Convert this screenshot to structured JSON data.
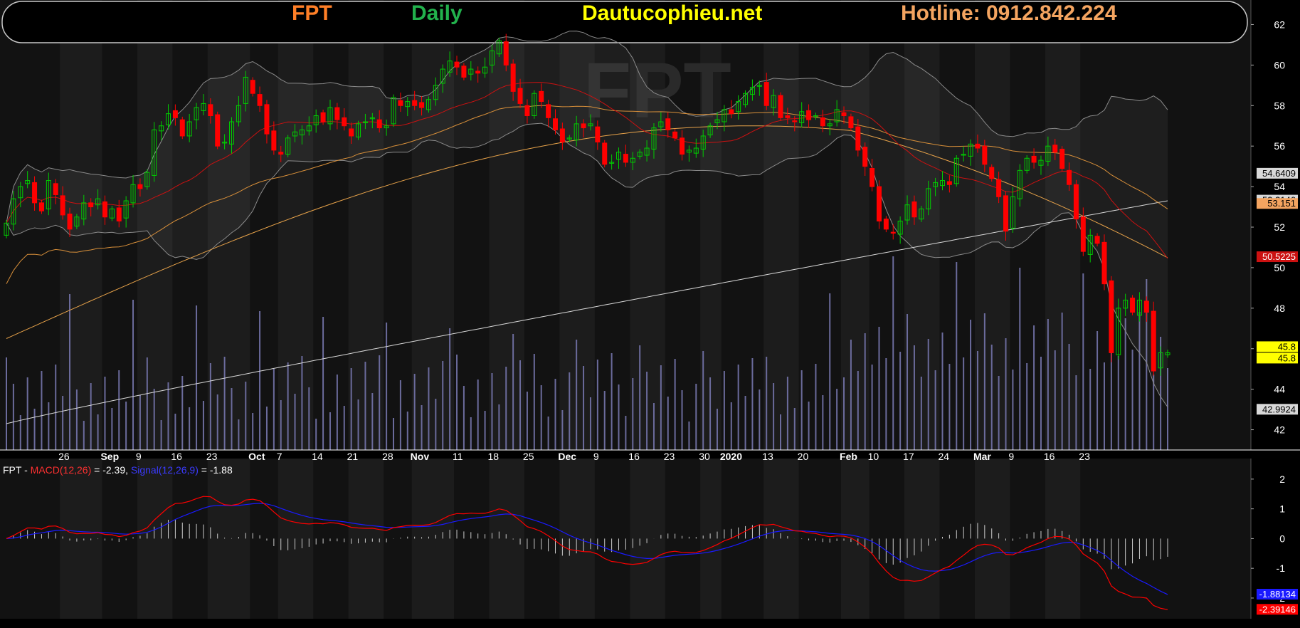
{
  "header": {
    "symbol": "FPT",
    "period": "Daily",
    "site": "Dautucophieu.net",
    "hotline": "Hotline: 0912.842.224",
    "watermark": "FPT"
  },
  "colors": {
    "background": "#000000",
    "pane": "#121212",
    "band": "#1c1c1c",
    "up": "#00cc00",
    "down": "#ff0000",
    "ma20": "#cc1111",
    "ma50": "#d9903a",
    "ma100": "#e8a34a",
    "ma200": "#d8d8d8",
    "bollinger": "#8a8a8a",
    "volume": "#6b6b9c",
    "macd": "#ff0000",
    "signal": "#1a1aff",
    "hist": "#cccccc",
    "symbol": "#ff7f27",
    "period": "#22b14c",
    "site": "#ffff00",
    "hotline": "#f4a460"
  },
  "macd_legend": {
    "symbol": "FPT",
    "sep1": " - ",
    "macd_label": "MACD(12,26)",
    "macd_value": " = -2.39, ",
    "signal_label": "Signal(12,26,9)",
    "signal_value": " = -1.88"
  },
  "price_tags": [
    {
      "text": "54.6409",
      "value": 54.6409,
      "bg": "#d8d8d8",
      "fg": "#000000"
    },
    {
      "text": "53.3146",
      "value": 53.3146,
      "bg": "#d8d8d8",
      "fg": "#000000"
    },
    {
      "text": "53.151",
      "value": 53.151,
      "bg": "#f4a460",
      "fg": "#000000"
    },
    {
      "text": "50.5225",
      "value": 50.5225,
      "bg": "#cc1111",
      "fg": "#ffffff"
    },
    {
      "text": "45.8",
      "value": 45.8,
      "bg": "#ffff00",
      "fg": "#000000",
      "dy": -8
    },
    {
      "text": "45.8",
      "value": 45.8,
      "bg": "#ffff00",
      "fg": "#000000",
      "dy": 8
    },
    {
      "text": "42.9924",
      "value": 42.9924,
      "bg": "#d8d8d8",
      "fg": "#000000"
    }
  ],
  "macd_tags": [
    {
      "text": "-1.88134",
      "value": -1.88134,
      "bg": "#1a1aff",
      "fg": "#ffffff"
    },
    {
      "text": "-2.39146",
      "value": -2.39146,
      "bg": "#ff0000",
      "fg": "#ffffff"
    }
  ],
  "chart_data": [
    {
      "type": "candlestick",
      "ylim": [
        41,
        63
      ],
      "y_ticks": [
        42,
        44,
        46,
        48,
        50,
        52,
        54,
        56,
        58,
        60,
        62
      ],
      "grid": false,
      "x_tick_labels": [
        {
          "label": "26",
          "bar": 8,
          "bold": false
        },
        {
          "label": "Sep",
          "bar": 14,
          "bold": true
        },
        {
          "label": "9",
          "bar": 19,
          "bold": false
        },
        {
          "label": "16",
          "bar": 24,
          "bold": false
        },
        {
          "label": "23",
          "bar": 29,
          "bold": false
        },
        {
          "label": "Oct",
          "bar": 35,
          "bold": true
        },
        {
          "label": "7",
          "bar": 39,
          "bold": false
        },
        {
          "label": "14",
          "bar": 44,
          "bold": false
        },
        {
          "label": "21",
          "bar": 49,
          "bold": false
        },
        {
          "label": "28",
          "bar": 54,
          "bold": false
        },
        {
          "label": "Nov",
          "bar": 58,
          "bold": true
        },
        {
          "label": "11",
          "bar": 64,
          "bold": false
        },
        {
          "label": "18",
          "bar": 69,
          "bold": false
        },
        {
          "label": "25",
          "bar": 74,
          "bold": false
        },
        {
          "label": "Dec",
          "bar": 79,
          "bold": true
        },
        {
          "label": "9",
          "bar": 84,
          "bold": false
        },
        {
          "label": "16",
          "bar": 89,
          "bold": false
        },
        {
          "label": "23",
          "bar": 94,
          "bold": false
        },
        {
          "label": "30",
          "bar": 99,
          "bold": false
        },
        {
          "label": "2020",
          "bar": 102,
          "bold": true
        },
        {
          "label": "13",
          "bar": 108,
          "bold": false
        },
        {
          "label": "20",
          "bar": 113,
          "bold": false
        },
        {
          "label": "Feb",
          "bar": 119,
          "bold": true
        },
        {
          "label": "10",
          "bar": 123,
          "bold": false
        },
        {
          "label": "17",
          "bar": 128,
          "bold": false
        },
        {
          "label": "24",
          "bar": 133,
          "bold": false
        },
        {
          "label": "Mar",
          "bar": 138,
          "bold": true
        },
        {
          "label": "9",
          "bar": 143,
          "bold": false
        },
        {
          "label": "16",
          "bar": 148,
          "bold": false
        },
        {
          "label": "23",
          "bar": 153,
          "bold": false
        }
      ],
      "close": [
        52.2,
        53.4,
        54.0,
        54.3,
        53.2,
        52.8,
        54.3,
        53.6,
        52.6,
        51.9,
        52.5,
        53.2,
        53.0,
        53.4,
        52.5,
        52.9,
        52.3,
        53.3,
        54.1,
        53.9,
        54.7,
        56.8,
        57.0,
        57.6,
        57.4,
        56.5,
        57.2,
        57.9,
        58.1,
        57.5,
        56.0,
        56.2,
        57.2,
        58.0,
        59.4,
        58.6,
        58.0,
        56.6,
        55.8,
        55.6,
        56.4,
        56.7,
        56.8,
        57.0,
        57.5,
        57.2,
        57.9,
        57.3,
        57.0,
        56.5,
        57.1,
        57.2,
        57.4,
        56.9,
        57.0,
        58.4,
        58.0,
        58.2,
        58.0,
        57.9,
        58.3,
        59.0,
        59.8,
        60.2,
        59.9,
        59.4,
        59.8,
        59.6,
        59.9,
        60.7,
        61.2,
        60.0,
        58.7,
        58.1,
        57.5,
        58.6,
        58.2,
        57.4,
        56.8,
        56.2,
        56.4,
        57.1,
        56.9,
        57.1,
        56.2,
        55.1,
        55.2,
        55.7,
        55.2,
        55.4,
        55.7,
        55.9,
        56.9,
        57.2,
        56.8,
        56.4,
        55.6,
        55.8,
        55.9,
        56.5,
        57.0,
        57.3,
        57.8,
        57.6,
        58.2,
        58.6,
        58.9,
        59.0,
        58.0,
        58.5,
        57.4,
        57.4,
        57.2,
        57.7,
        57.3,
        57.5,
        57.0,
        57.1,
        57.8,
        57.5,
        56.9,
        55.8,
        55.0,
        54.0,
        52.3,
        51.9,
        51.7,
        52.3,
        53.1,
        52.5,
        52.9,
        53.9,
        54.2,
        54.3,
        54.1,
        55.4,
        55.6,
        56.1,
        55.9,
        55.1,
        54.4,
        53.5,
        51.8,
        53.5,
        54.8,
        55.4,
        55.2,
        55.3,
        56.0,
        55.7,
        54.9,
        54.1,
        52.4,
        50.8,
        51.6,
        51.2,
        49.2,
        45.8,
        48.0,
        48.4,
        47.8,
        48.4,
        47.8,
        44.9,
        45.8,
        45.8
      ],
      "moving_averages": [
        {
          "name": "MA20",
          "color": "#cc1111",
          "period": 20
        },
        {
          "name": "MA50",
          "color": "#d9903a",
          "period": 50
        },
        {
          "name": "MA100",
          "color": "#e8a34a",
          "period": 100
        },
        {
          "name": "MA200",
          "color": "#d8d8d8",
          "period": 200
        }
      ],
      "bollinger": {
        "period": 20,
        "width": 2
      }
    },
    {
      "type": "line",
      "ylim": [
        -2.6,
        2.5
      ],
      "y_ticks": [
        -2,
        -1,
        0,
        1,
        2
      ],
      "series": [
        {
          "name": "MACD(12,26)",
          "color": "#ff0000",
          "last": -2.39
        },
        {
          "name": "Signal(12,26,9)",
          "color": "#1a1aff",
          "last": -1.88
        }
      ]
    }
  ]
}
